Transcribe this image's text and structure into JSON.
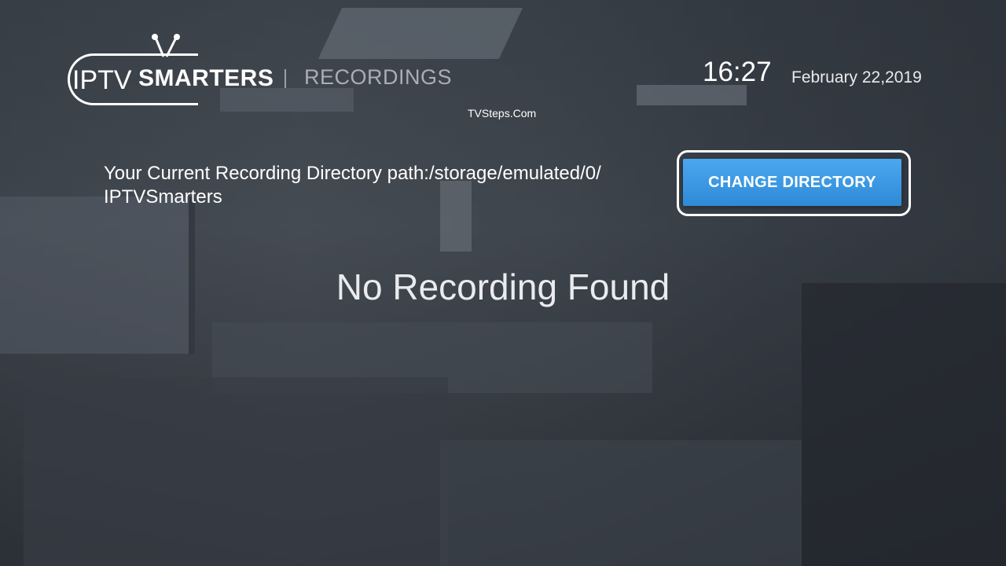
{
  "header": {
    "logo": {
      "part1": "IPTV",
      "part2": "SMARTERS"
    },
    "section_title": "RECORDINGS",
    "time": "16:27",
    "date": "February 22,2019"
  },
  "watermark": "TVSteps.Com",
  "directory": {
    "path_text": "Your Current Recording Directory path:/storage/emulated/0/\nIPTVSmarters",
    "change_button_label": "CHANGE DIRECTORY"
  },
  "empty_state": "No Recording Found",
  "colors": {
    "button_blue": "#3d99e3",
    "text_white": "#ffffff",
    "title_gray": "#a9aeb5"
  }
}
